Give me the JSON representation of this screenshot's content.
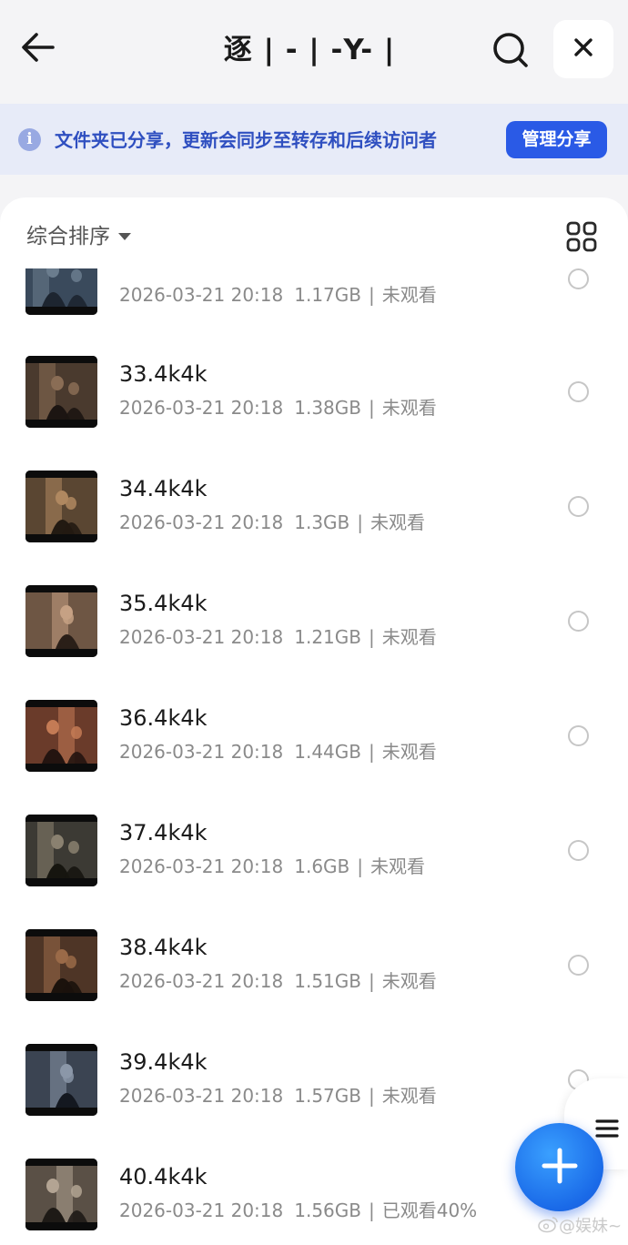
{
  "header": {
    "back_icon": "arrow-left-icon",
    "title": "逐 | - | -Y- |",
    "search_icon": "search-icon",
    "close_icon": "close-icon"
  },
  "banner": {
    "icon": "info-icon",
    "info_glyph": "i",
    "text": "文件夹已分享，更新会同步至转存和后续访问者",
    "button_label": "管理分享",
    "colors": {
      "background": "#e7ebf8",
      "text": "#2f4fc0",
      "button": "#2a5ae6"
    }
  },
  "toolbar": {
    "sort_label": "综合排序",
    "sort_icon": "caret-down-icon",
    "view_icon": "grid-view-icon"
  },
  "files": [
    {
      "name": "",
      "date": "2026-03-21 20:18",
      "size": "1.17GB",
      "status": "未观看",
      "checked": false
    },
    {
      "name": "33.4k4k",
      "date": "2026-03-21 20:18",
      "size": "1.38GB",
      "status": "未观看",
      "checked": false
    },
    {
      "name": "34.4k4k",
      "date": "2026-03-21 20:18",
      "size": "1.3GB",
      "status": "未观看",
      "checked": false
    },
    {
      "name": "35.4k4k",
      "date": "2026-03-21 20:18",
      "size": "1.21GB",
      "status": "未观看",
      "checked": false
    },
    {
      "name": "36.4k4k",
      "date": "2026-03-21 20:18",
      "size": "1.44GB",
      "status": "未观看",
      "checked": false
    },
    {
      "name": "37.4k4k",
      "date": "2026-03-21 20:18",
      "size": "1.6GB",
      "status": "未观看",
      "checked": false
    },
    {
      "name": "38.4k4k",
      "date": "2026-03-21 20:18",
      "size": "1.51GB",
      "status": "未观看",
      "checked": false
    },
    {
      "name": "39.4k4k",
      "date": "2026-03-21 20:18",
      "size": "1.57GB",
      "status": "未观看",
      "checked": false
    },
    {
      "name": "40.4k4k",
      "date": "2026-03-21 20:18",
      "size": "1.56GB",
      "status": "已观看40%",
      "checked": false
    }
  ],
  "meta_separator": "|",
  "fab": {
    "icon": "plus-icon",
    "menu_icon": "menu-icon",
    "color": "#1a6ae8"
  },
  "watermark": "@娱妹~",
  "watermark_icon": "weibo-icon"
}
